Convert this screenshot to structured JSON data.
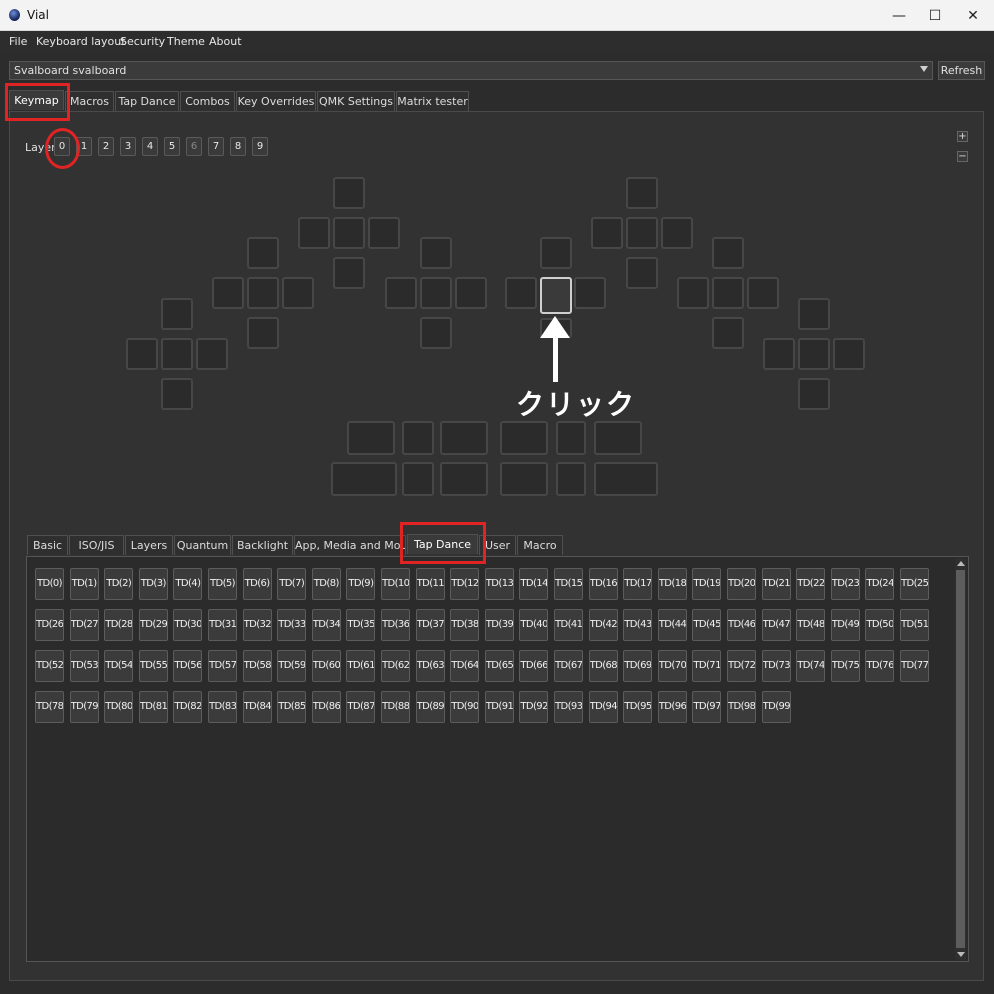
{
  "window": {
    "title": "Vial",
    "minimize": "—",
    "maximize": "☐",
    "close": "✕"
  },
  "menu": [
    "File",
    "Keyboard layout",
    "Security",
    "Theme",
    "About"
  ],
  "keyboard_select": {
    "value": "Svalboard svalboard",
    "refresh_label": "Refresh"
  },
  "main_tabs": [
    "Keymap",
    "Macros",
    "Tap Dance",
    "Combos",
    "Key Overrides",
    "QMK Settings",
    "Matrix tester"
  ],
  "main_tabs_active": "Keymap",
  "layers": {
    "label": "Layer",
    "buttons": [
      "0",
      "1",
      "2",
      "3",
      "4",
      "5",
      "6",
      "7",
      "8",
      "9"
    ],
    "active": "0",
    "disabled": [
      "6"
    ]
  },
  "zoom": {
    "plus": "+",
    "minus": "−"
  },
  "annotation": {
    "text": "クリック",
    "highlight_color": "#e02424"
  },
  "keycode_tabs": [
    "Basic",
    "ISO/JIS",
    "Layers",
    "Quantum",
    "Backlight",
    "App, Media and Mouse",
    "Tap Dance",
    "User",
    "Macro"
  ],
  "keycode_tabs_active": "Tap Dance",
  "tapdance_keys": [
    "TD(0)",
    "TD(1)",
    "TD(2)",
    "TD(3)",
    "TD(4)",
    "TD(5)",
    "TD(6)",
    "TD(7)",
    "TD(8)",
    "TD(9)",
    "TD(10)",
    "TD(11)",
    "TD(12)",
    "TD(13)",
    "TD(14)",
    "TD(15)",
    "TD(16)",
    "TD(17)",
    "TD(18)",
    "TD(19)",
    "TD(20)",
    "TD(21)",
    "TD(22)",
    "TD(23)",
    "TD(24)",
    "TD(25)",
    "TD(26)",
    "TD(27)",
    "TD(28)",
    "TD(29)",
    "TD(30)",
    "TD(31)",
    "TD(32)",
    "TD(33)",
    "TD(34)",
    "TD(35)",
    "TD(36)",
    "TD(37)",
    "TD(38)",
    "TD(39)",
    "TD(40)",
    "TD(41)",
    "TD(42)",
    "TD(43)",
    "TD(44)",
    "TD(45)",
    "TD(46)",
    "TD(47)",
    "TD(48)",
    "TD(49)",
    "TD(50)",
    "TD(51)",
    "TD(52)",
    "TD(53)",
    "TD(54)",
    "TD(55)",
    "TD(56)",
    "TD(57)",
    "TD(58)",
    "TD(59)",
    "TD(60)",
    "TD(61)",
    "TD(62)",
    "TD(63)",
    "TD(64)",
    "TD(65)",
    "TD(66)",
    "TD(67)",
    "TD(68)",
    "TD(69)",
    "TD(70)",
    "TD(71)",
    "TD(72)",
    "TD(73)",
    "TD(74)",
    "TD(75)",
    "TD(76)",
    "TD(77)",
    "TD(78)",
    "TD(79)",
    "TD(80)",
    "TD(81)",
    "TD(82)",
    "TD(83)",
    "TD(84)",
    "TD(85)",
    "TD(86)",
    "TD(87)",
    "TD(88)",
    "TD(89)",
    "TD(90)",
    "TD(91)",
    "TD(92)",
    "TD(93)",
    "TD(94)",
    "TD(95)",
    "TD(96)",
    "TD(97)",
    "TD(98)",
    "TD(99)"
  ]
}
